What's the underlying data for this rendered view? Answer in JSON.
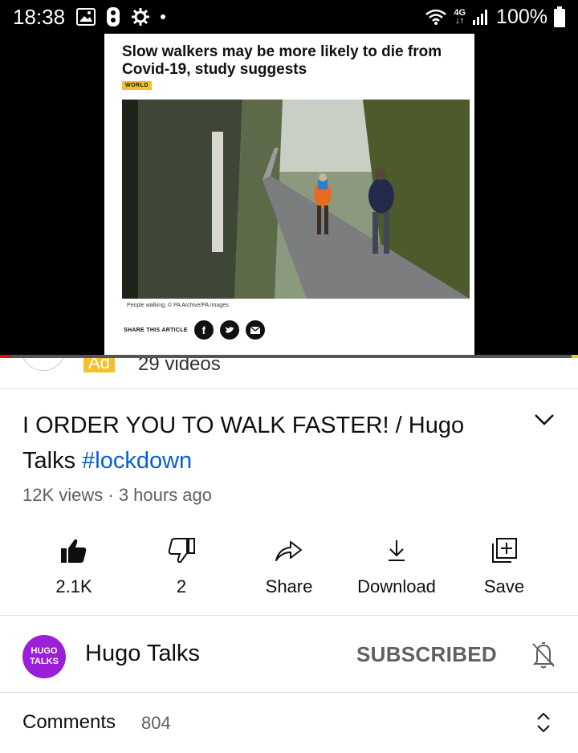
{
  "status_bar": {
    "time": "18:38",
    "network": "4G",
    "battery": "100%"
  },
  "video": {
    "article_headline": "Slow walkers may be more likely to die from Covid-19, study suggests",
    "article_tag": "WORLD",
    "photo_caption": "People walking, © PA Archive/PA Images",
    "share_label": "SHARE THIS ARTICLE",
    "progress_fraction": 0.017
  },
  "ad_row": {
    "ad_badge": "Ad",
    "videos_count": "29 videos"
  },
  "video_info": {
    "title_text": "I ORDER YOU TO WALK FASTER! / Hugo Talks",
    "hashtag": "#lockdown",
    "meta": "12K views · 3 hours ago"
  },
  "actions": [
    {
      "label": "2.1K",
      "icon": "thumbs-up-filled-icon"
    },
    {
      "label": "2",
      "icon": "thumbs-down-icon"
    },
    {
      "label": "Share",
      "icon": "share-icon"
    },
    {
      "label": "Download",
      "icon": "download-icon"
    },
    {
      "label": "Save",
      "icon": "save-to-playlist-icon"
    }
  ],
  "channel": {
    "logo_text": "HUGO TALKS",
    "name": "Hugo Talks",
    "subscribe_state": "SUBSCRIBED"
  },
  "comments": {
    "label": "Comments",
    "count": "804"
  },
  "colors": {
    "accent_blue": "#065fd4",
    "channel_purple": "#9b1fd8",
    "ad_yellow": "#f4c12a",
    "progress_red": "#ff0000"
  }
}
